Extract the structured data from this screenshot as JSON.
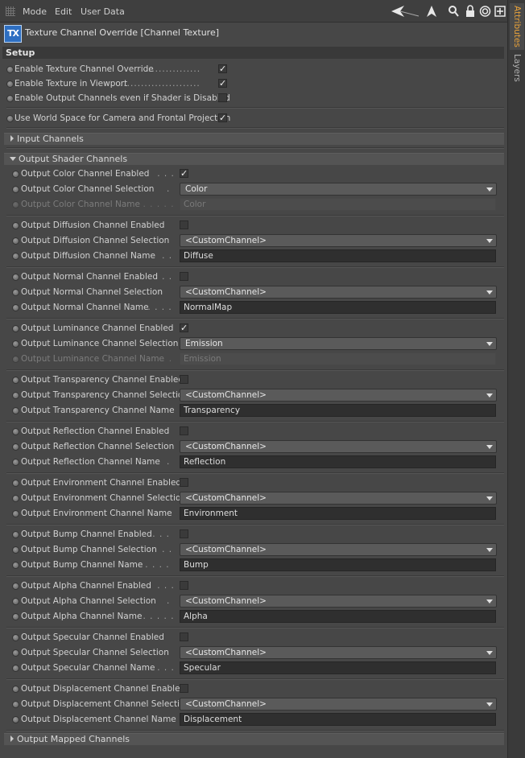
{
  "menubar": {
    "items": [
      "Mode",
      "Edit",
      "User Data"
    ]
  },
  "toolbar_icons": [
    "back-arrow-icon",
    "cursor-up-icon",
    "search-icon",
    "lock-icon",
    "target-icon",
    "new-panel-icon"
  ],
  "object": {
    "icon_text": "TX",
    "title": "Texture Channel Override [Channel Texture]"
  },
  "setup": {
    "title": "Setup",
    "rows": [
      {
        "label": "Enable Texture Channel Override",
        "checked": true
      },
      {
        "label": "Enable Texture in Viewport",
        "checked": true
      },
      {
        "label": "Enable Output Channels even if Shader is Disabled",
        "checked": false
      },
      {
        "label": "Use World Space for Camera and Frontal Projection",
        "checked": true
      }
    ]
  },
  "groups": {
    "input": "Input Channels",
    "output": "Output Shader Channels",
    "mapped": "Output Mapped Channels"
  },
  "channels": [
    {
      "enabled_label": "Output Color Channel Enabled",
      "selection_label": "Output Color Channel Selection",
      "name_label": "Output Color Channel Name",
      "enabled": true,
      "selection": "Color",
      "name": "Color",
      "name_disabled": true
    },
    {
      "enabled_label": "Output Diffusion Channel Enabled",
      "selection_label": "Output Diffusion Channel Selection",
      "name_label": "Output Diffusion Channel Name",
      "enabled": false,
      "selection": "<CustomChannel>",
      "name": "Diffuse",
      "name_disabled": false
    },
    {
      "enabled_label": "Output Normal Channel Enabled",
      "selection_label": "Output Normal Channel Selection",
      "name_label": "Output Normal Channel Name",
      "enabled": false,
      "selection": "<CustomChannel>",
      "name": "NormalMap",
      "name_disabled": false
    },
    {
      "enabled_label": "Output Luminance Channel Enabled",
      "selection_label": "Output Luminance Channel Selection",
      "name_label": "Output Luminance Channel Name",
      "enabled": true,
      "selection": "Emission",
      "name": "Emission",
      "name_disabled": true
    },
    {
      "enabled_label": "Output Transparency Channel Enabled",
      "selection_label": "Output Transparency Channel Selection",
      "name_label": "Output Transparency Channel Name",
      "enabled": false,
      "selection": "<CustomChannel>",
      "name": "Transparency",
      "name_disabled": false
    },
    {
      "enabled_label": "Output Reflection Channel Enabled",
      "selection_label": "Output Reflection Channel Selection",
      "name_label": "Output Reflection Channel Name",
      "enabled": false,
      "selection": "<CustomChannel>",
      "name": "Reflection",
      "name_disabled": false
    },
    {
      "enabled_label": "Output Environment Channel Enabled",
      "selection_label": "Output Environment Channel Selection",
      "name_label": "Output Environment Channel Name",
      "enabled": false,
      "selection": "<CustomChannel>",
      "name": "Environment",
      "name_disabled": false
    },
    {
      "enabled_label": "Output Bump Channel Enabled",
      "selection_label": "Output Bump Channel Selection",
      "name_label": "Output Bump Channel Name",
      "enabled": false,
      "selection": "<CustomChannel>",
      "name": "Bump",
      "name_disabled": false
    },
    {
      "enabled_label": "Output Alpha Channel Enabled",
      "selection_label": "Output Alpha Channel Selection",
      "name_label": "Output Alpha Channel Name",
      "enabled": false,
      "selection": "<CustomChannel>",
      "name": "Alpha",
      "name_disabled": false
    },
    {
      "enabled_label": "Output Specular Channel Enabled",
      "selection_label": "Output Specular Channel Selection",
      "name_label": "Output Specular Channel Name",
      "enabled": false,
      "selection": "<CustomChannel>",
      "name": "Specular",
      "name_disabled": false
    },
    {
      "enabled_label": "Output Displacement Channel Enabled",
      "selection_label": "Output Displacement Channel Selection",
      "name_label": "Output Displacement Channel Name",
      "enabled": false,
      "selection": "<CustomChannel>",
      "name": "Displacement",
      "name_disabled": false
    }
  ],
  "side_tabs": [
    "Attributes",
    "Layers"
  ],
  "colors": {
    "active_tab": "#e8a23a",
    "background": "#474747",
    "field": "#2f2f2f",
    "logo": "#2e6fc2"
  }
}
